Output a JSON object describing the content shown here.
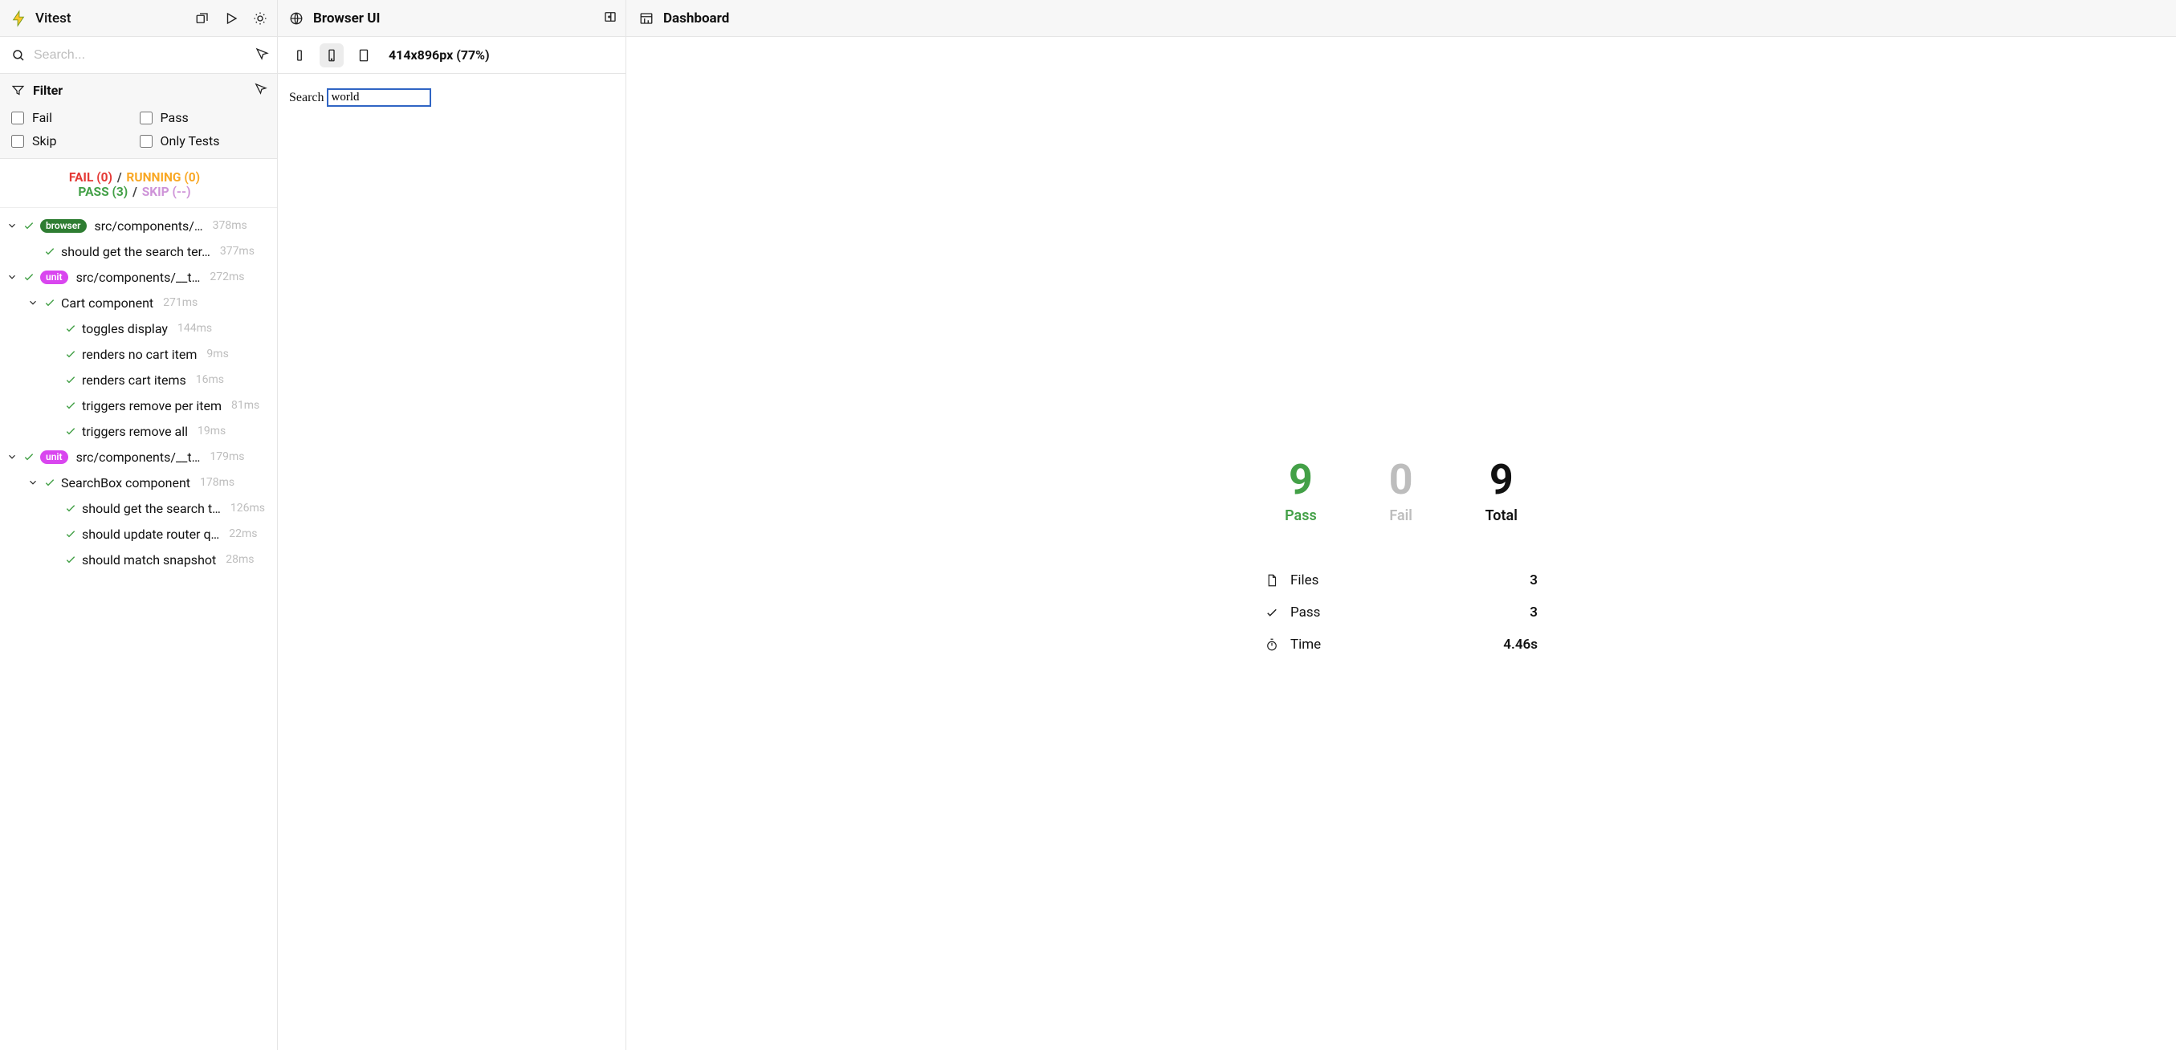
{
  "sidebar": {
    "title": "Vitest",
    "search_placeholder": "Search...",
    "filter": {
      "title": "Filter",
      "fail": "Fail",
      "pass": "Pass",
      "skip": "Skip",
      "only": "Only Tests"
    },
    "status": {
      "fail_label": "FAIL (0)",
      "running_label": "RUNNING (0)",
      "pass_label": "PASS (3)",
      "skip_label": "SKIP (--)"
    },
    "tree": [
      {
        "level": 0,
        "expandable": true,
        "badge": "browser",
        "label": "src/components/…",
        "dur": "378ms"
      },
      {
        "level": 1,
        "expandable": false,
        "label": "should get the search ter…",
        "dur": "377ms"
      },
      {
        "level": 0,
        "expandable": true,
        "badge": "unit",
        "label": "src/components/__t…",
        "dur": "272ms"
      },
      {
        "level": 1,
        "expandable": true,
        "label": "Cart component",
        "dur": "271ms"
      },
      {
        "level": 2,
        "expandable": false,
        "label": "toggles display",
        "dur": "144ms"
      },
      {
        "level": 2,
        "expandable": false,
        "label": "renders no cart item",
        "dur": "9ms"
      },
      {
        "level": 2,
        "expandable": false,
        "label": "renders cart items",
        "dur": "16ms"
      },
      {
        "level": 2,
        "expandable": false,
        "label": "triggers remove per item",
        "dur": "81ms"
      },
      {
        "level": 2,
        "expandable": false,
        "label": "triggers remove all",
        "dur": "19ms"
      },
      {
        "level": 0,
        "expandable": true,
        "badge": "unit",
        "label": "src/components/__t…",
        "dur": "179ms"
      },
      {
        "level": 1,
        "expandable": true,
        "label": "SearchBox component",
        "dur": "178ms"
      },
      {
        "level": 2,
        "expandable": false,
        "label": "should get the search t…",
        "dur": "126ms"
      },
      {
        "level": 2,
        "expandable": false,
        "label": "should update router q…",
        "dur": "22ms"
      },
      {
        "level": 2,
        "expandable": false,
        "label": "should match snapshot",
        "dur": "28ms"
      }
    ]
  },
  "middle": {
    "title": "Browser UI",
    "viewport_label": "414x896px (77%)",
    "page": {
      "search_label": "Search",
      "search_value": "world"
    }
  },
  "dashboard": {
    "title": "Dashboard",
    "metrics": {
      "pass": {
        "value": "9",
        "label": "Pass"
      },
      "fail": {
        "value": "0",
        "label": "Fail"
      },
      "total": {
        "value": "9",
        "label": "Total"
      }
    },
    "stats": {
      "files": {
        "label": "Files",
        "value": "3"
      },
      "pass": {
        "label": "Pass",
        "value": "3"
      },
      "time": {
        "label": "Time",
        "value": "4.46s"
      }
    }
  }
}
